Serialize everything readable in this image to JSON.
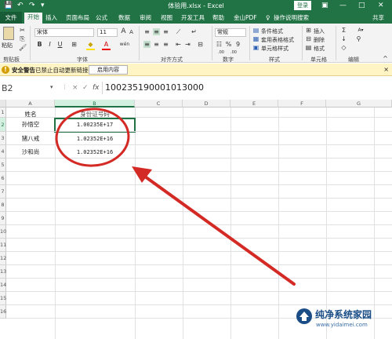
{
  "titlebar": {
    "title": "体验用.xlsx  -  Excel",
    "login": "登录",
    "qa_save": "💾",
    "qa_undo": "↶",
    "qa_redo": "↷",
    "qa_more": "▾",
    "ribbon_opts": "▣",
    "minimize": "—",
    "restore": "□",
    "close": "✕"
  },
  "tabs": {
    "file": "文件",
    "items": [
      "开始",
      "插入",
      "页面布局",
      "公式",
      "数据",
      "审阅",
      "视图",
      "开发工具",
      "帮助",
      "金山PDF",
      "操作说明搜索"
    ],
    "share": "共享",
    "tell_icon": "♀"
  },
  "ribbon": {
    "paste": "粘贴",
    "clipboard": "剪贴板",
    "font_name": "宋体",
    "font_size": "11",
    "grow": "A",
    "shrink": "A",
    "bold": "B",
    "italic": "I",
    "underline": "U",
    "font_group": "字体",
    "wen": "wén",
    "align_group": "对齐方式",
    "number_format": "常规",
    "number_group": "数字",
    "currency": "☷",
    "percent": "%",
    "comma": "9",
    "dec_inc": ".00",
    "dec_dec": ".00",
    "cond_format": "条件格式",
    "table_format": "套用表格格式",
    "cell_style": "单元格样式",
    "style_group": "样式",
    "insert": "插入",
    "delete": "删除",
    "format": "格式",
    "cells_group": "单元格",
    "sum": "Σ",
    "sort": "A▾",
    "find": "⚲",
    "edit_group": "编辑"
  },
  "security": {
    "title": "安全警告",
    "message": "已禁止自动更新链接",
    "button": "启用内容",
    "close": "×"
  },
  "formula": {
    "name_box": "B2",
    "cancel": "×",
    "confirm": "✓",
    "fx": "fx",
    "content": "100235190001013000"
  },
  "sheet": {
    "columns": [
      "A",
      "B",
      "C",
      "D",
      "E",
      "F",
      "G"
    ],
    "rows": [
      "1",
      "2",
      "3",
      "4",
      "5",
      "6",
      "7",
      "8",
      "9",
      "10",
      "11",
      "12",
      "13",
      "14",
      "15",
      "16"
    ],
    "header_a": "姓名",
    "header_b": "身份证号码",
    "data": [
      {
        "name": "孙悟空",
        "id": "1.00235E+17"
      },
      {
        "name": "猪八戒",
        "id": "1.02352E+16"
      },
      {
        "name": "沙和尚",
        "id": "1.02352E+16"
      }
    ]
  },
  "watermark": {
    "site_name": "纯净系统家园",
    "site_url": "www.yidaimei.com"
  },
  "colors": {
    "accent": "#217346",
    "annotation": "#d42a25",
    "watermark": "#1a4d86"
  }
}
